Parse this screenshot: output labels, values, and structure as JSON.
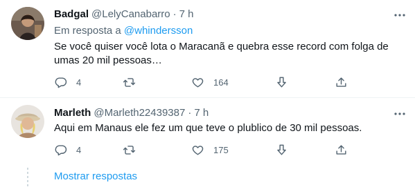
{
  "tweets": [
    {
      "name": "Badgal",
      "handle": "@LelyCanabarro",
      "separator": "·",
      "time": "7 h",
      "reply_prefix": "Em resposta a",
      "reply_mention": "@whindersson",
      "text": "Se você quiser você lota o Maracanã e quebra esse record com folga de umas 20 mil pessoas…",
      "replies": "4",
      "retweets": "",
      "likes": "164"
    },
    {
      "name": "Marleth",
      "handle": "@Marleth22439387",
      "separator": "·",
      "time": "7 h",
      "text": "Aqui em Manaus ele fez um que teve o plublico de 30 mil pessoas.",
      "replies": "4",
      "retweets": "",
      "likes": "175"
    }
  ],
  "show_replies_label": "Mostrar respostas",
  "icons": {
    "more": "more-icon",
    "reply": "reply-icon",
    "retweet": "retweet-icon",
    "like": "like-icon",
    "downvote": "downvote-icon",
    "share": "share-icon"
  },
  "colors": {
    "link": "#1d9bf0",
    "secondary_text": "#536471",
    "primary_text": "#0f1419"
  }
}
